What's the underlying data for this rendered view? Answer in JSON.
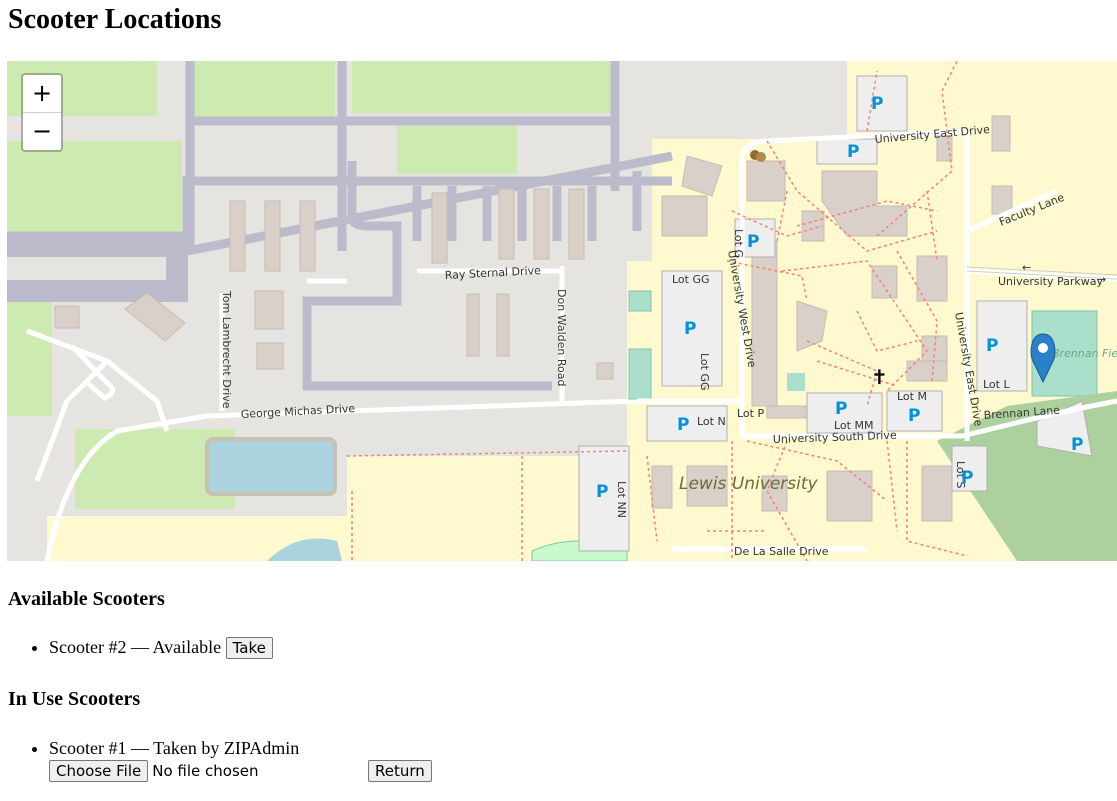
{
  "page": {
    "title": "Scooter Locations"
  },
  "map": {
    "zoom_in": "+",
    "zoom_out": "−",
    "labels": {
      "ray_sternal": "Ray Sternal Drive",
      "don_walden": "Don Walden Road",
      "tom_lambrecht": "Tom Lambrecht Drive",
      "george_michas": "George Michas Drive",
      "university_east": "University East Drive",
      "faculty_lane": "Faculty Lane",
      "university_parkway": "University Parkway",
      "university_west": "University West Drive",
      "university_east_vertical": "University East Drive",
      "university_south": "University South Drive",
      "brennan_lane": "Brennan Lane",
      "de_la_salle": "De La Salle Drive",
      "lewis_university": "Lewis University",
      "brennan_field": "Brennan Field",
      "lot_gg": "Lot GG",
      "lot_gg_vert": "Lot GG",
      "lot_g": "Lot G",
      "lot_n": "Lot N",
      "lot_p": "Lot P",
      "lot_mm": "Lot MM",
      "lot_m": "Lot M",
      "lot_l": "Lot L",
      "lot_nn": "Lot NN",
      "lot_s": "Lot S",
      "parking": "P",
      "church": "✝"
    },
    "icons": [
      "plus-icon",
      "minus-icon",
      "map-marker-icon",
      "parking-icon",
      "theatre-icon",
      "church-icon"
    ],
    "colors": {
      "grass": "#cdebb0",
      "campus": "#fff9cf",
      "apron": "#e0dfdf",
      "taxiway": "#bbbbcc",
      "building": "#d9d0c9",
      "water": "#aad3df",
      "parking_fill": "#eeeeee",
      "park": "#c8facc",
      "path": "#fa8072",
      "marker": "#2a81cb"
    }
  },
  "available": {
    "heading": "Available Scooters",
    "items": [
      {
        "text": "Scooter #2 — Available",
        "button": "Take"
      }
    ]
  },
  "in_use": {
    "heading": "In Use Scooters",
    "items": [
      {
        "text": "Scooter #1 — Taken by ZIPAdmin",
        "file_button": "Choose File",
        "file_status": "No file chosen",
        "button": "Return"
      }
    ]
  }
}
